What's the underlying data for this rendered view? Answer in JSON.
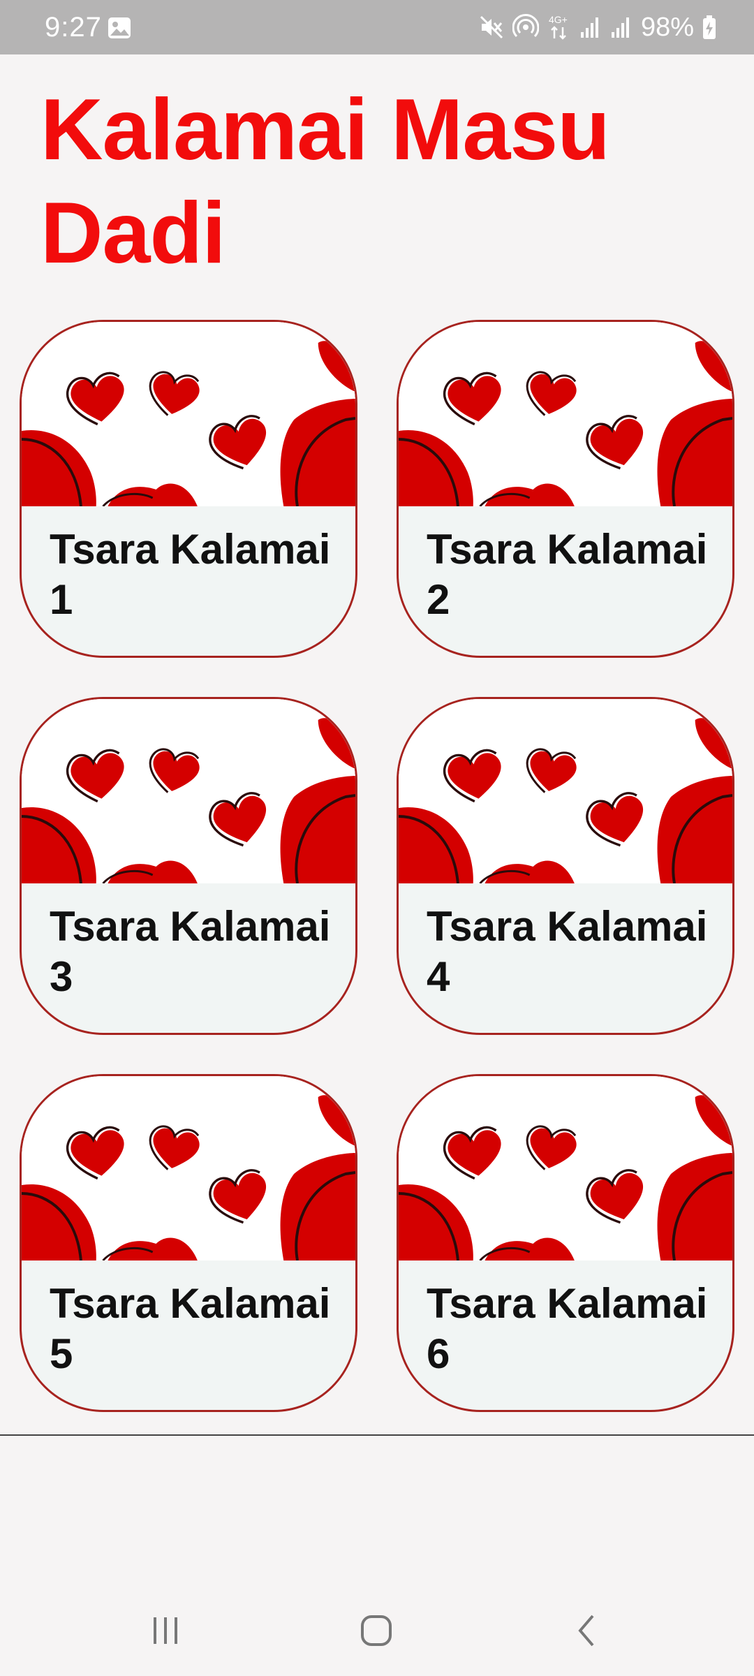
{
  "status_bar": {
    "time": "9:27",
    "battery": "98%",
    "network": "4G+",
    "icons": [
      "gallery-icon",
      "mute-icon",
      "hotspot-icon",
      "network-4g-icon",
      "signal-icon",
      "signal-icon",
      "battery-charging-icon"
    ]
  },
  "page": {
    "title": "Kalamai Masu Dadi"
  },
  "cards": [
    {
      "label": "Tsara Kalamai 1"
    },
    {
      "label": "Tsara Kalamai 2"
    },
    {
      "label": "Tsara Kalamai 3"
    },
    {
      "label": "Tsara Kalamai 4"
    },
    {
      "label": "Tsara Kalamai 5"
    },
    {
      "label": "Tsara Kalamai 6"
    }
  ],
  "nav_bar": {
    "icons": [
      "recent-apps-icon",
      "home-icon",
      "back-icon"
    ]
  },
  "colors": {
    "title": "#f20c0c",
    "card_border": "#a7231f",
    "card_background": "#f1f5f4",
    "heart": "#d40000",
    "status_bar": "#b5b4b4"
  }
}
